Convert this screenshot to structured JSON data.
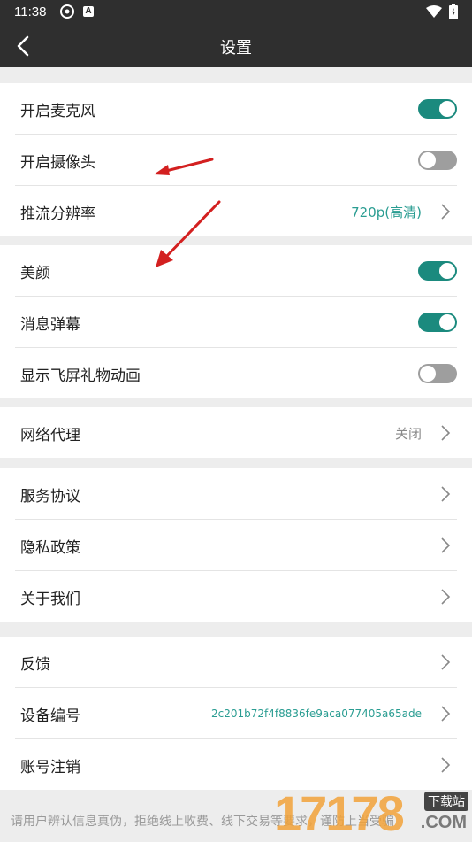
{
  "status": {
    "time": "11:38",
    "app_icon_letter": "A"
  },
  "header": {
    "title": "设置"
  },
  "groups": {
    "g1": [
      {
        "label": "开启麦克风",
        "toggle": true
      },
      {
        "label": "开启摄像头",
        "toggle": false
      },
      {
        "label": "推流分辨率",
        "value": "720p(高清)"
      }
    ],
    "g2": [
      {
        "label": "美颜",
        "toggle": true
      },
      {
        "label": "消息弹幕",
        "toggle": true
      },
      {
        "label": "显示飞屏礼物动画",
        "toggle": false
      }
    ],
    "g3": [
      {
        "label": "网络代理",
        "value": "关闭"
      }
    ],
    "g4": [
      {
        "label": "服务协议"
      },
      {
        "label": "隐私政策"
      },
      {
        "label": "关于我们"
      }
    ],
    "g5": [
      {
        "label": "反馈"
      },
      {
        "label": "设备编号",
        "value": "2c201b72f4f8836fe9aca077405a65ade"
      },
      {
        "label": "账号注销"
      }
    ]
  },
  "footer": {
    "notice": "请用户辨认信息真伪，拒绝线上收费、线下交易等要求，谨防上当受骗"
  },
  "watermark": {
    "digits": "17178",
    "label": "下载站",
    "suffix": ".COM"
  },
  "colors": {
    "accent": "#1b8a7e",
    "arrow": "#d32020"
  }
}
